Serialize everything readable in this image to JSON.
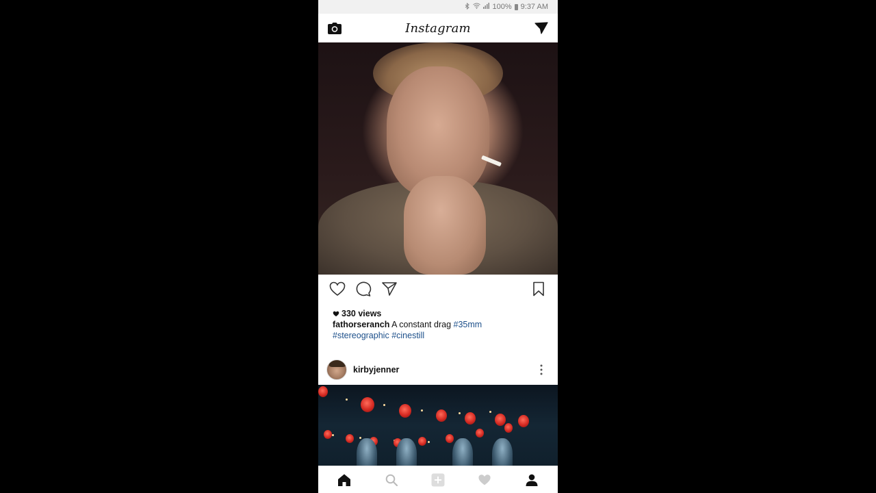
{
  "status_bar": {
    "battery": "100%",
    "time": "9:37 AM"
  },
  "header": {
    "logo": "Instagram",
    "left_icon": "camera-icon",
    "right_icon": "direct-message-icon"
  },
  "post1": {
    "views": "330 views",
    "username": "fathorseranch",
    "caption": "A constant drag",
    "tags": [
      "#35mm",
      "#stereographic",
      "#cinestill"
    ],
    "actions": [
      "heart-icon",
      "comment-icon",
      "share-icon",
      "bookmark-icon"
    ]
  },
  "post2": {
    "username": "kirbyjenner"
  },
  "bottom_nav": [
    "home-icon",
    "search-icon",
    "add-post-icon",
    "activity-heart-icon",
    "profile-icon"
  ],
  "colors": {
    "hashtag": "#1c4f8a",
    "background": "#000000",
    "text": "#111111"
  }
}
